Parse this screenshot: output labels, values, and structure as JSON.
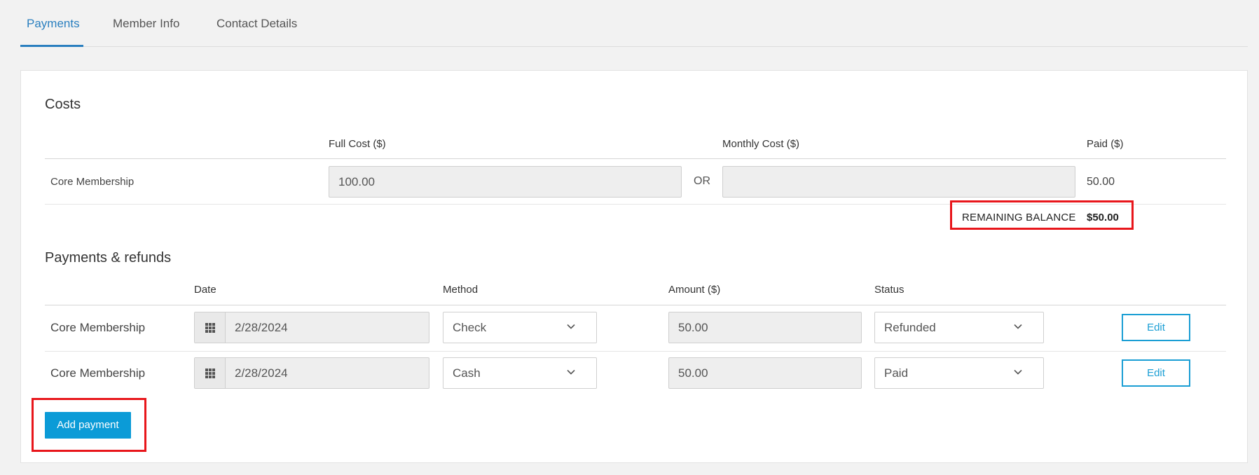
{
  "tabs": [
    {
      "label": "Payments",
      "active": true
    },
    {
      "label": "Member Info",
      "active": false
    },
    {
      "label": "Contact Details",
      "active": false
    }
  ],
  "costs": {
    "title": "Costs",
    "headers": {
      "full_cost": "Full Cost ($)",
      "monthly_cost": "Monthly Cost ($)",
      "paid": "Paid ($)"
    },
    "row": {
      "label": "Core Membership",
      "full_cost": "100.00",
      "or_text": "OR",
      "monthly_cost": "",
      "paid": "50.00"
    },
    "remaining_balance_label": "REMAINING BALANCE",
    "remaining_balance_value": "$50.00"
  },
  "payments": {
    "title": "Payments & refunds",
    "headers": {
      "date": "Date",
      "method": "Method",
      "amount": "Amount ($)",
      "status": "Status"
    },
    "rows": [
      {
        "label": "Core Membership",
        "date": "2/28/2024",
        "method": "Check",
        "amount": "50.00",
        "status": "Refunded",
        "edit": "Edit"
      },
      {
        "label": "Core Membership",
        "date": "2/28/2024",
        "method": "Cash",
        "amount": "50.00",
        "status": "Paid",
        "edit": "Edit"
      }
    ],
    "add_button": "Add payment"
  },
  "colors": {
    "accent": "#2a7fbf",
    "button": "#0b9bd7",
    "highlight": "#e8161b"
  },
  "icons": {
    "calendar": "calendar-grid-icon",
    "chevron": "chevron-down-icon"
  }
}
